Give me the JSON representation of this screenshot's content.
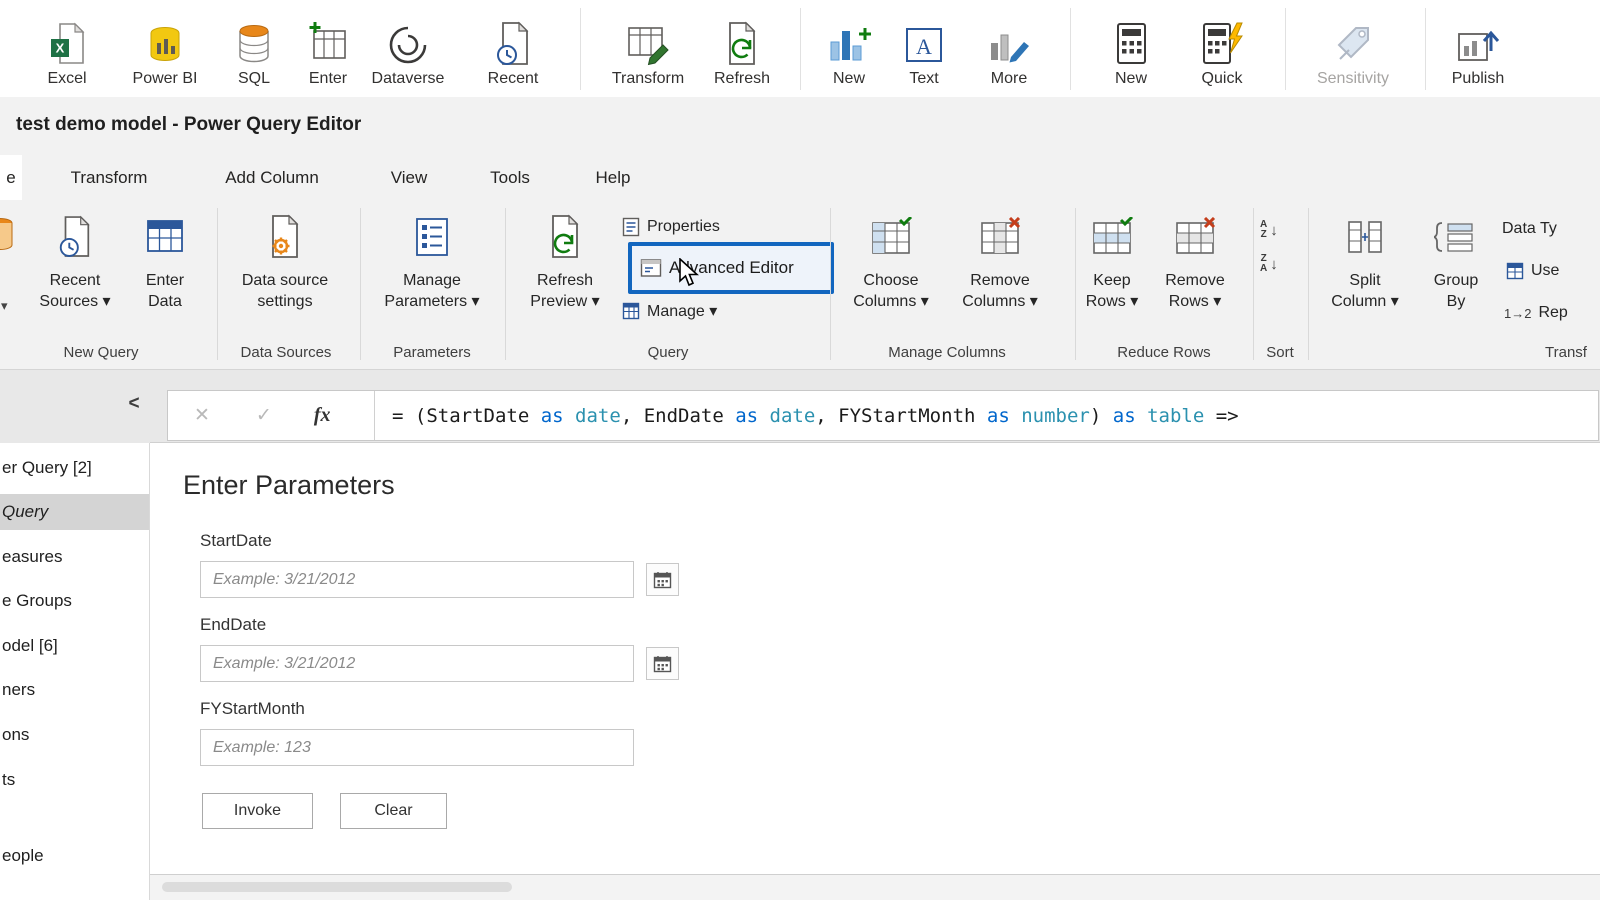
{
  "top_ribbon": {
    "items": [
      {
        "label": "Excel"
      },
      {
        "label": "Power BI"
      },
      {
        "label": "SQL"
      },
      {
        "label": "Enter"
      },
      {
        "label": "Dataverse"
      },
      {
        "label": "Recent"
      },
      {
        "label": "Transform"
      },
      {
        "label": "Refresh"
      },
      {
        "label": "New"
      },
      {
        "label": "Text"
      },
      {
        "label": "More"
      },
      {
        "label": "New"
      },
      {
        "label": "Quick"
      },
      {
        "label": "Sensitivity"
      },
      {
        "label": "Publish"
      }
    ]
  },
  "window": {
    "title": "test demo model - Power Query Editor"
  },
  "menu": {
    "tabs": [
      {
        "label": "e"
      },
      {
        "label": "Transform"
      },
      {
        "label": "Add Column"
      },
      {
        "label": "View"
      },
      {
        "label": "Tools"
      },
      {
        "label": "Help"
      }
    ]
  },
  "ribbon": {
    "group_labels": [
      {
        "label": "New Query"
      },
      {
        "label": "Data Sources"
      },
      {
        "label": "Parameters"
      },
      {
        "label": "Query"
      },
      {
        "label": "Manage Columns"
      },
      {
        "label": "Reduce Rows"
      },
      {
        "label": "Sort"
      },
      {
        "label": "Transf"
      }
    ],
    "items": {
      "new_source_dropdown": "▾",
      "recent_sources": "Recent\nSources ▾",
      "enter_data": "Enter\nData",
      "data_source_settings": "Data source\nsettings",
      "manage_parameters": "Manage\nParameters ▾",
      "refresh_preview": "Refresh\nPreview ▾",
      "properties": "Properties",
      "advanced_editor": "Advanced Editor",
      "manage": "Manage ▾",
      "choose_columns": "Choose\nColumns ▾",
      "remove_columns": "Remove\nColumns ▾",
      "keep_rows": "Keep\nRows ▾",
      "remove_rows": "Remove\nRows ▾",
      "sort_az": "A\nZ",
      "sort_za": "Z\nA",
      "sort_arrow": "↓",
      "split_column": "Split\nColumn ▾",
      "group_by": "Group\nBy",
      "data_type": "Data Ty",
      "use_headers": "Use",
      "replace_values_glyph": "1→2",
      "replace_values": "Rep"
    }
  },
  "formula_bar": {
    "cancel_glyph": "✕",
    "commit_glyph": "✓",
    "fx": "fx",
    "tokens": [
      {
        "text": "= (StartDate "
      },
      {
        "text": "as"
      },
      {
        "text": " date"
      },
      {
        "text": ", EndDate "
      },
      {
        "text": "as"
      },
      {
        "text": " date"
      },
      {
        "text": ", FYStartMonth "
      },
      {
        "text": "as"
      },
      {
        "text": " number"
      },
      {
        "text": ") "
      },
      {
        "text": "as"
      },
      {
        "text": " table"
      },
      {
        "text": " =>"
      }
    ]
  },
  "sidebar": {
    "collapse": "<",
    "items": [
      {
        "label": "er Query [2]"
      },
      {
        "label": "Query",
        "selected": true
      },
      {
        "label": "easures"
      },
      {
        "label": "e Groups"
      },
      {
        "label": "odel [6]"
      },
      {
        "label": "ners"
      },
      {
        "label": "ons"
      },
      {
        "label": "ts"
      },
      {
        "label": "eople"
      }
    ]
  },
  "parameters": {
    "heading": "Enter Parameters",
    "fields": [
      {
        "label": "StartDate",
        "placeholder": "Example: 3/21/2012"
      },
      {
        "label": "EndDate",
        "placeholder": "Example: 3/21/2012"
      },
      {
        "label": "FYStartMonth",
        "placeholder": "Example: 123"
      }
    ],
    "invoke_label": "Invoke",
    "clear_label": "Clear"
  },
  "colors": {
    "advanced_editor_highlight": "#1266bf",
    "keyword_color": "#0066cc",
    "type_color": "#2b91af",
    "excel_green": "#1e7145",
    "powerbi_yellow": "#f2c811",
    "accent_blue": "#2b579a"
  }
}
